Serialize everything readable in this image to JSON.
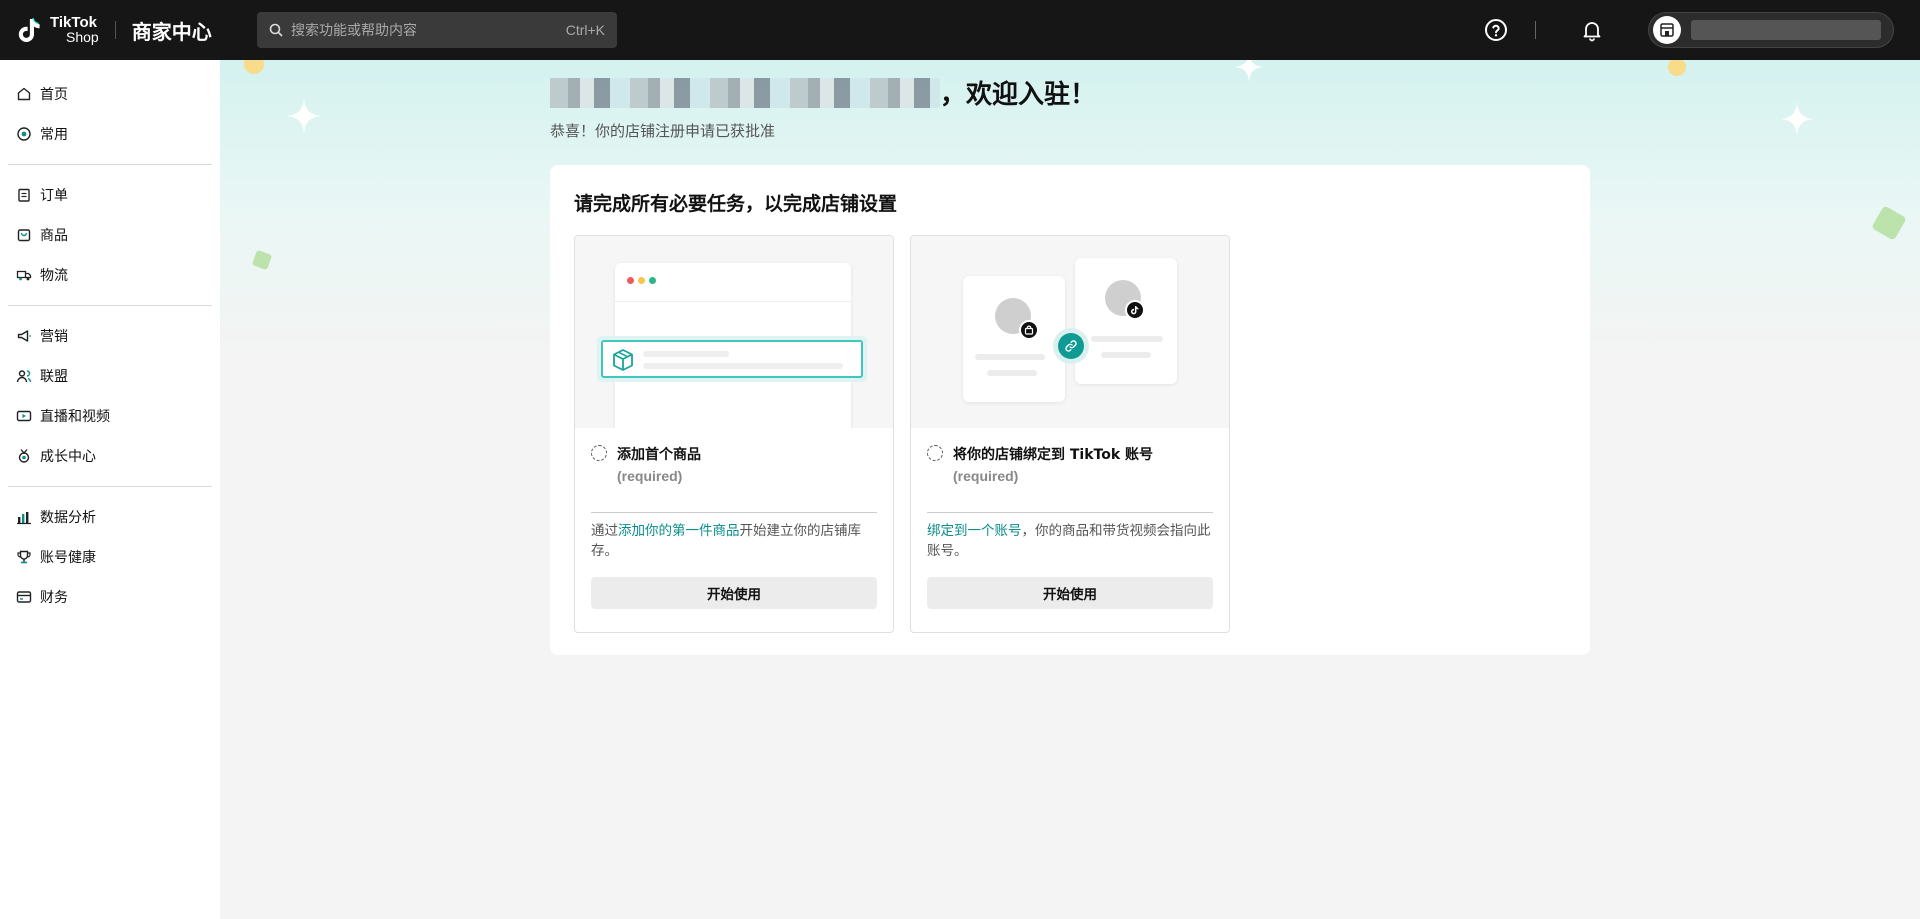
{
  "header": {
    "logo_line1": "TikTok",
    "logo_line2": "Shop",
    "app_title": "商家中心",
    "search_placeholder": "搜索功能或帮助内容",
    "search_shortcut": "Ctrl+K",
    "icons": [
      "help-icon",
      "bell-icon",
      "shop-icon"
    ]
  },
  "sidebar": {
    "groups": [
      [
        {
          "label": "首页",
          "icon": "home-icon"
        },
        {
          "label": "常用",
          "icon": "favorites-icon"
        }
      ],
      [
        {
          "label": "订单",
          "icon": "orders-icon"
        },
        {
          "label": "商品",
          "icon": "products-icon"
        },
        {
          "label": "物流",
          "icon": "logistics-icon"
        }
      ],
      [
        {
          "label": "营销",
          "icon": "marketing-icon"
        },
        {
          "label": "联盟",
          "icon": "affiliate-icon"
        },
        {
          "label": "直播和视频",
          "icon": "live-video-icon"
        },
        {
          "label": "成长中心",
          "icon": "growth-icon"
        }
      ],
      [
        {
          "label": "数据分析",
          "icon": "analytics-icon"
        },
        {
          "label": "账号健康",
          "icon": "trophy-icon"
        },
        {
          "label": "财务",
          "icon": "finance-icon"
        }
      ]
    ]
  },
  "main": {
    "welcome_suffix": "，欢迎入驻！",
    "subtitle": "恭喜！你的店铺注册申请已获批准",
    "card_title": "请完成所有必要任务，以完成店铺设置",
    "tasks": [
      {
        "title": "添加首个商品",
        "required": "(required)",
        "desc_pre": "通过",
        "desc_link": "添加你的第一件商品",
        "desc_post": "开始建立你的店铺库存。",
        "button": "开始使用"
      },
      {
        "title": "将你的店铺绑定到 TikTok 账号",
        "required": "(required)",
        "desc_pre": "",
        "desc_link": "绑定到一个账号",
        "desc_post": "，你的商品和带货视频会指向此账号。",
        "button": "开始使用"
      }
    ]
  },
  "colors": {
    "topbar": "#161616",
    "accent": "#0a8e8a",
    "hero_gradient_top": "#d4f2ef"
  }
}
